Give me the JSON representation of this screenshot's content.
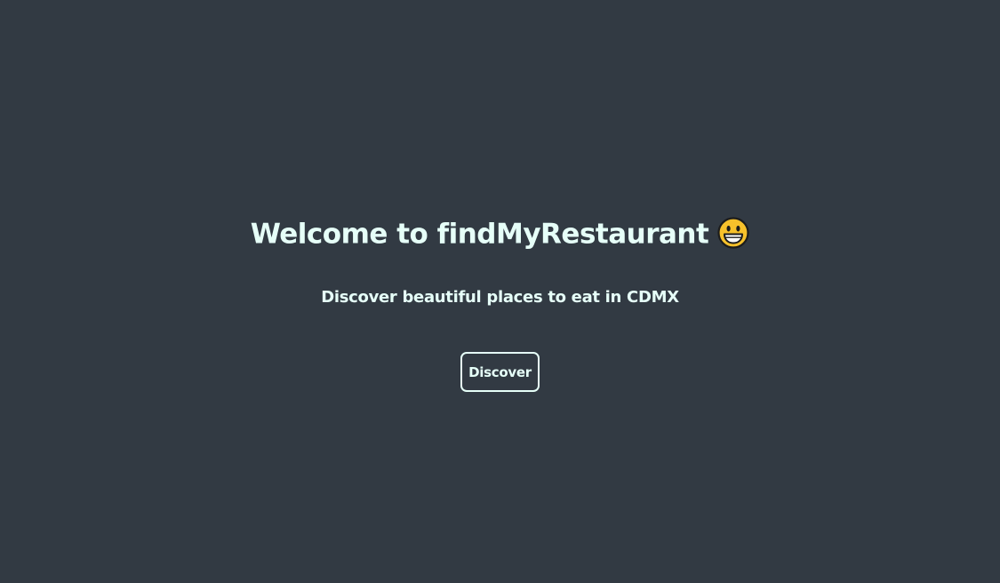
{
  "hero": {
    "title": "Welcome to findMyRestaurant",
    "title_emoji_icon": "grinning-face-icon",
    "subtitle": "Discover beautiful places to eat in CDMX",
    "button_label": "Discover"
  },
  "colors": {
    "background": "#323a43",
    "text": "#e6fff8",
    "emoji_face": "#f7c12b",
    "emoji_outline": "#1c1c1c"
  }
}
